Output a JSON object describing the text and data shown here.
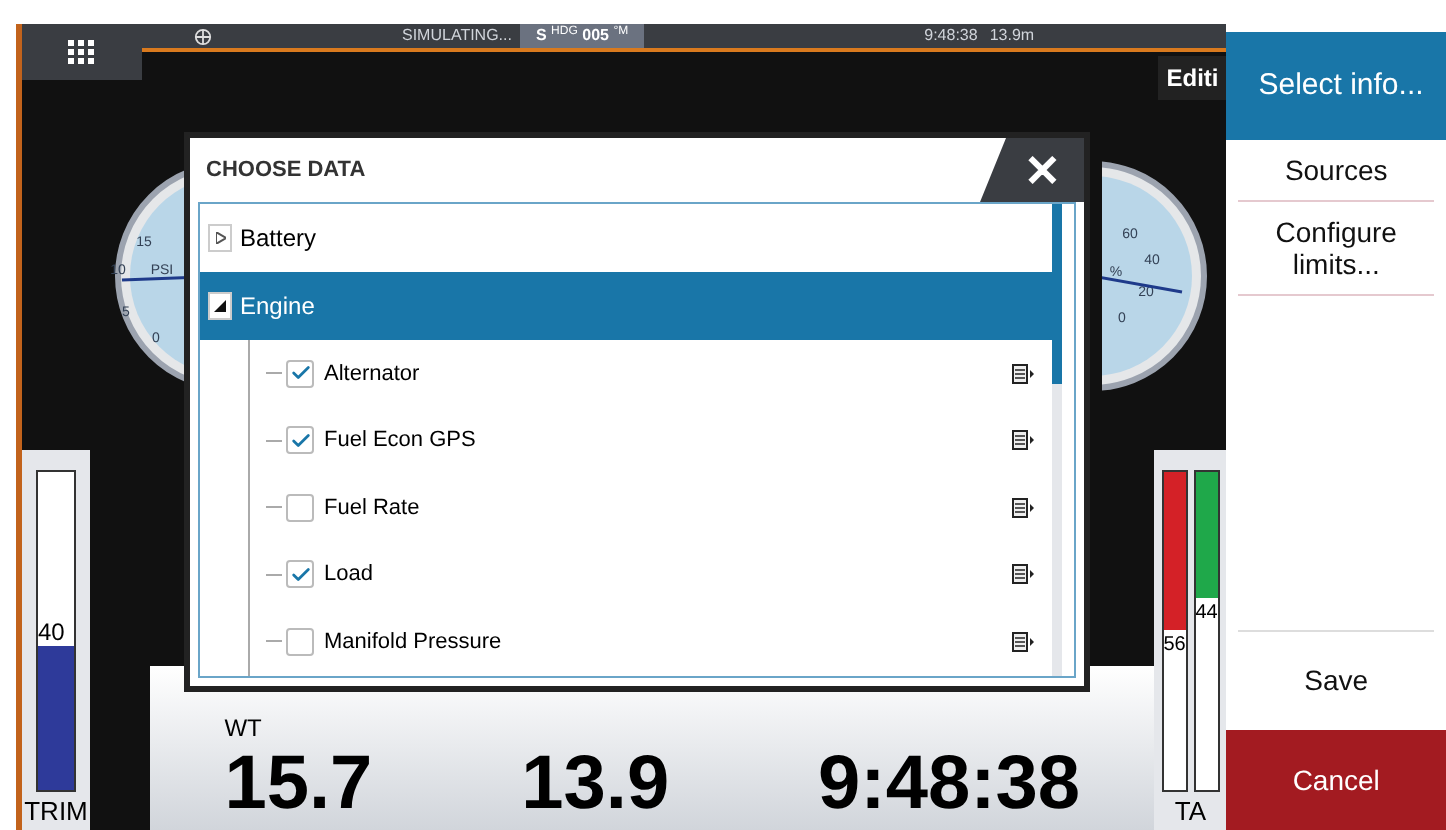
{
  "status_bar": {
    "mode": "SIMULATING...",
    "heading_prefix": "S",
    "heading_label": "HDG",
    "heading_value": "005",
    "heading_unit": "°M",
    "time": "9:48:38",
    "depth": "13.9m"
  },
  "edit_tab": "Editi",
  "gauges": [
    {
      "labels": [
        "15",
        "10",
        "PSI",
        "5",
        "0"
      ]
    },
    {
      "labels": [
        "60",
        "40",
        "%",
        "20",
        "0"
      ]
    }
  ],
  "trim": {
    "reading": "40",
    "label": "TRIM",
    "level": 0.45
  },
  "tabs_meter": {
    "label": "TA",
    "bars": [
      {
        "color": "#d42127",
        "level": 0.5,
        "reading": "56"
      },
      {
        "color": "#1fa84a",
        "level": 0.4,
        "reading": "44"
      }
    ]
  },
  "data_bar": {
    "fields": [
      {
        "label": "WT",
        "value": "15.7"
      },
      {
        "value": "13.9"
      },
      {
        "value": "9:48:38"
      }
    ]
  },
  "dialog": {
    "title": "CHOOSE DATA",
    "close": "✕",
    "items": [
      {
        "label": "Battery",
        "expanded": false,
        "selected": false
      },
      {
        "label": "Engine",
        "expanded": true,
        "selected": true,
        "children": [
          {
            "label": "Alternator",
            "checked": true
          },
          {
            "label": "Fuel Econ GPS",
            "checked": true
          },
          {
            "label": "Fuel Rate",
            "checked": false
          },
          {
            "label": "Load",
            "checked": true
          },
          {
            "label": "Manifold Pressure",
            "checked": false
          }
        ]
      }
    ]
  },
  "side_panel": {
    "title": "Select info...",
    "items": [
      "Sources",
      "Configure limits..."
    ],
    "save": "Save",
    "cancel": "Cancel"
  }
}
